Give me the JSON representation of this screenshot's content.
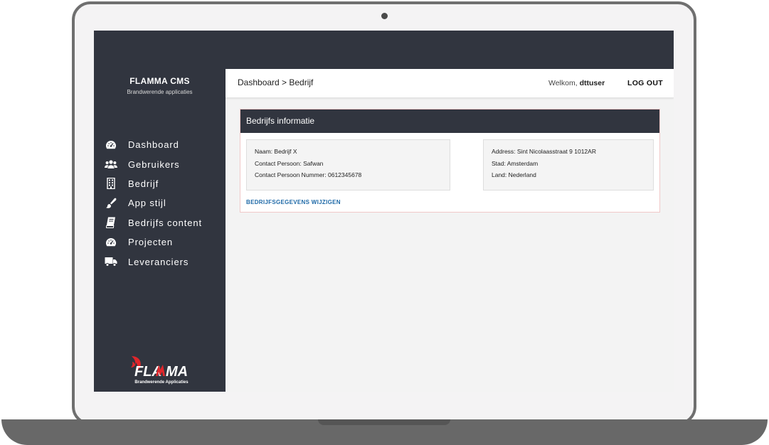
{
  "app": {
    "title": "FLAMMA CMS",
    "subtitle": "Brandwerende applicaties",
    "logo_text": "FLAMMA",
    "logo_subtext": "Brandwerende Applicaties"
  },
  "sidebar": {
    "items": [
      {
        "label": "Dashboard",
        "icon": "dashboard-icon"
      },
      {
        "label": "Gebruikers",
        "icon": "users-icon"
      },
      {
        "label": "Bedrijf",
        "icon": "building-icon"
      },
      {
        "label": "App stijl",
        "icon": "brush-icon"
      },
      {
        "label": "Bedrijfs content",
        "icon": "book-icon"
      },
      {
        "label": "Projecten",
        "icon": "dashboard-icon"
      },
      {
        "label": "Leveranciers",
        "icon": "truck-icon"
      }
    ]
  },
  "header": {
    "breadcrumb": "Dashboard > Bedrijf",
    "welcome_prefix": "Welkom,",
    "username": "dttuser",
    "logout_label": "LOG OUT"
  },
  "panel": {
    "title": "Bedrijfs informatie",
    "left": [
      {
        "key": "Naam:",
        "value": "Bedrijf X"
      },
      {
        "key": "Contact Persoon:",
        "value": "Safwan"
      },
      {
        "key": "Contact Persoon Nummer:",
        "value": "0612345678"
      }
    ],
    "right": [
      {
        "key": "Address:",
        "value": "Sint Nicolaasstraat 9 1012AR"
      },
      {
        "key": "Stad:",
        "value": "Amsterdam"
      },
      {
        "key": "Land:",
        "value": "Nederland"
      }
    ],
    "edit_label": "BEDRIJFSGEGEVENS WIJZIGEN"
  },
  "colors": {
    "sidebar_bg": "#31353f",
    "link": "#1f6aa8",
    "logo_red": "#e0262b"
  }
}
